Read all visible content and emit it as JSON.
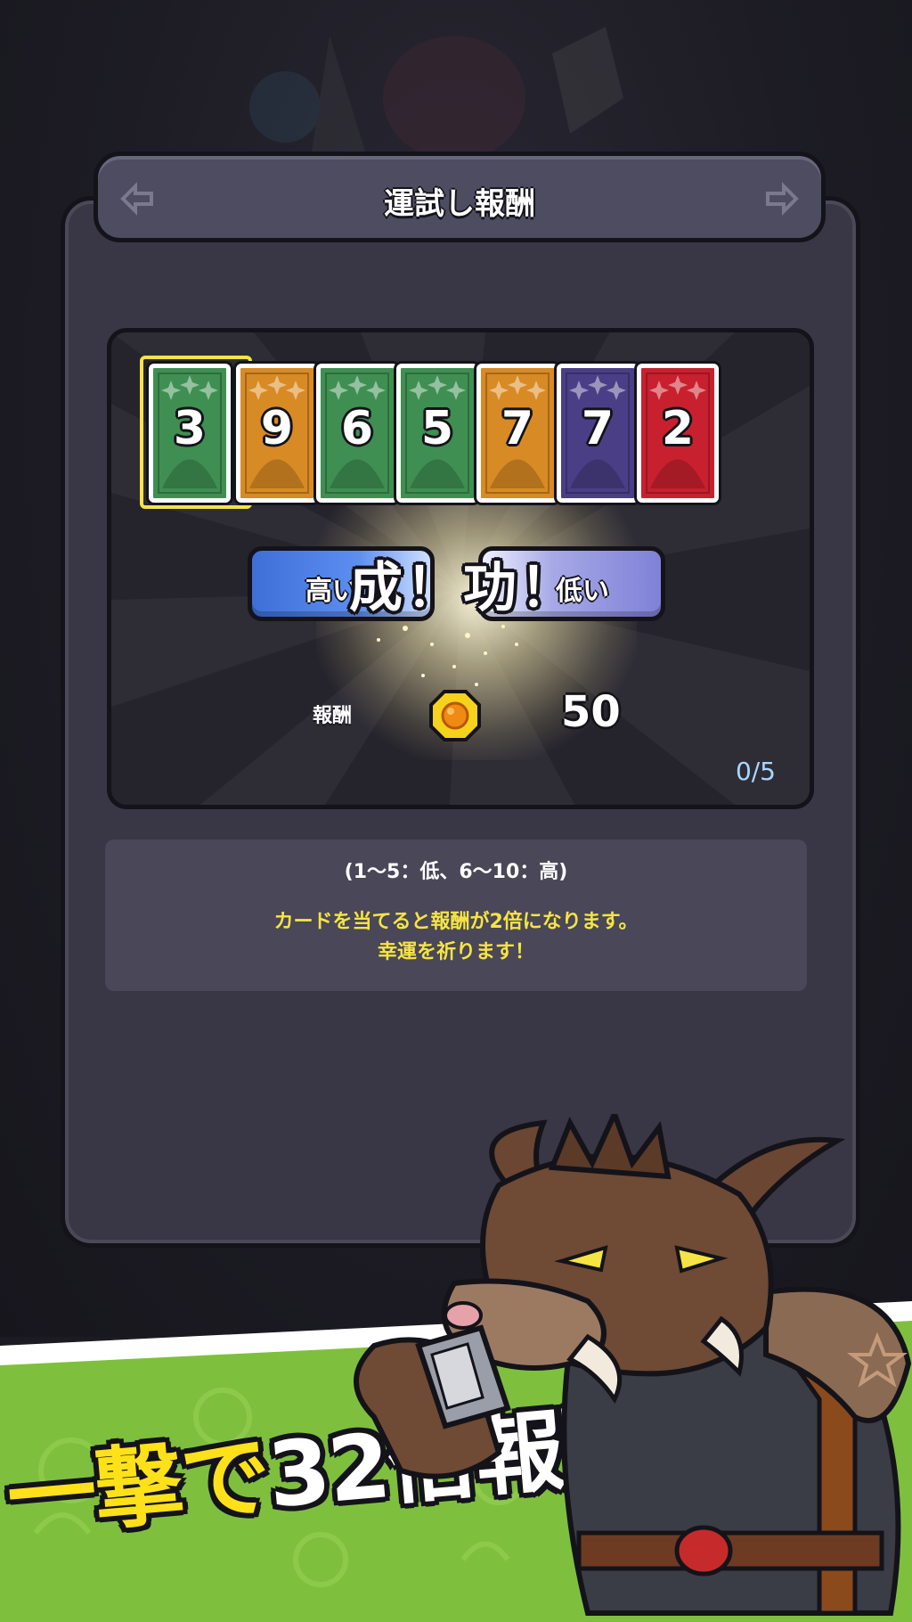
{
  "title": "運試し報酬",
  "cards": [
    {
      "value": "3",
      "color": "#3f8f52",
      "icon": "leaf-icon",
      "selected": true
    },
    {
      "value": "9",
      "color": "#d88a24",
      "icon": "sun-icon",
      "selected": false
    },
    {
      "value": "6",
      "color": "#3f8f52",
      "icon": "leaf-icon",
      "selected": false
    },
    {
      "value": "5",
      "color": "#3f8f52",
      "icon": "leaf-icon",
      "selected": false
    },
    {
      "value": "7",
      "color": "#d88a24",
      "icon": "sun-icon",
      "selected": false
    },
    {
      "value": "7",
      "color": "#4a3f86",
      "icon": "ghost-icon",
      "selected": false
    },
    {
      "value": "2",
      "color": "#c8202e",
      "icon": "flame-icon",
      "selected": false
    }
  ],
  "buttons": {
    "high_label": "高い",
    "low_label": "低い"
  },
  "result_text": "成！功！",
  "reward": {
    "label": "報酬",
    "icon": "coin-icon",
    "value": "50"
  },
  "counter": "0/5",
  "info": {
    "range": "(1〜5：低、6〜10：高)",
    "line1": "カードを当てると報酬が2倍になります。",
    "line2": "幸運を祈ります！"
  },
  "promo": {
    "part1": "一撃で",
    "part2": "32倍報酬！"
  },
  "colors": {
    "highlight": "#f7e24a",
    "panel": "#393745",
    "banner_green": "#7fbf3e"
  }
}
